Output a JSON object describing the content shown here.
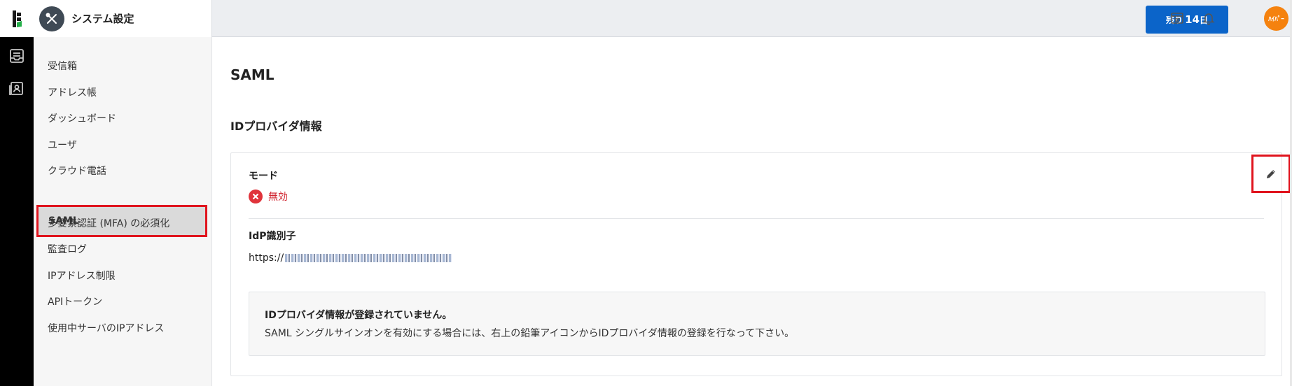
{
  "app": {
    "title": "システム設定"
  },
  "header": {
    "trial_prefix": "残り",
    "trial_days": "14",
    "trial_suffix": "日",
    "avatar_text": "ﾊｲﾊﾟｰ"
  },
  "sidebar": {
    "items": [
      {
        "label": "受信箱"
      },
      {
        "label": "アドレス帳"
      },
      {
        "label": "ダッシュボード"
      },
      {
        "label": "ユーザ"
      },
      {
        "label": "クラウド電話"
      },
      {
        "label": "SAML"
      },
      {
        "label": "多要素認証 (MFA) の必須化"
      },
      {
        "label": "監査ログ"
      },
      {
        "label": "IPアドレス制限"
      },
      {
        "label": "APIトークン"
      },
      {
        "label": "使用中サーバのIPアドレス"
      }
    ]
  },
  "main": {
    "page_title": "SAML",
    "section_title": "IDプロバイダ情報",
    "mode_label": "モード",
    "mode_status": "無効",
    "idp_label": "IdP識別子",
    "idp_prefix": "https://",
    "notice_title": "IDプロバイダ情報が登録されていません。",
    "notice_body": "SAML シングルサインオンを有効にする場合には、右上の鉛筆アイコンからIDプロバイダ情報の登録を行なって下さい。"
  },
  "colors": {
    "accent": "#0b64c9",
    "danger": "#e0333b",
    "highlight": "#e0141e",
    "avatar": "#f5820f"
  }
}
